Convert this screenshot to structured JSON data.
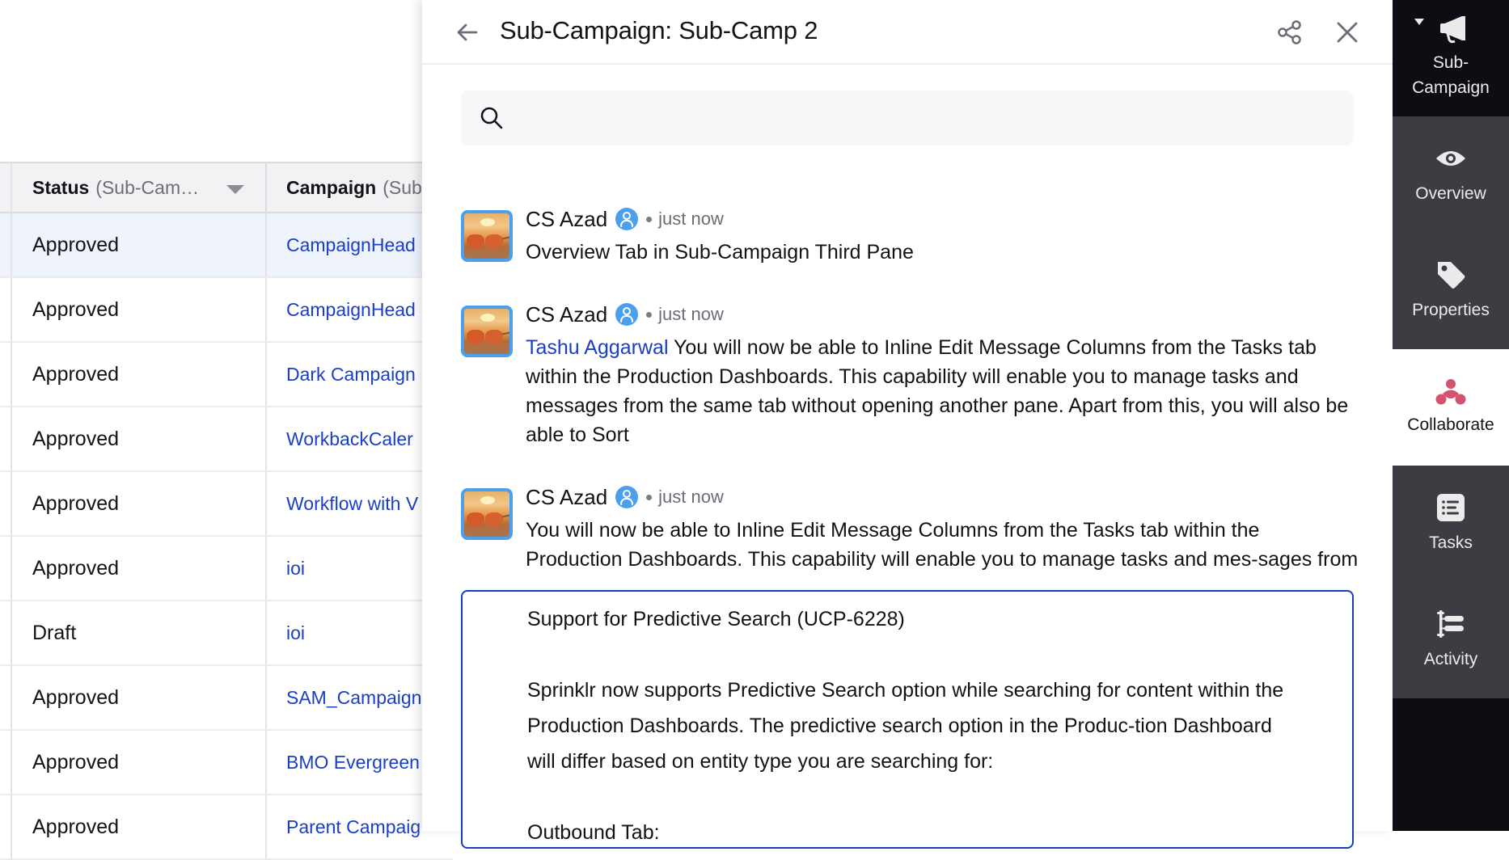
{
  "table": {
    "columns": [
      {
        "label": "Status",
        "sub_label": "(Sub-Cam…"
      },
      {
        "label": "Campaign",
        "sub_label": "(Sub"
      }
    ],
    "rows": [
      {
        "status": "Approved",
        "campaign": "CampaignHead",
        "selected": true
      },
      {
        "status": "Approved",
        "campaign": "CampaignHead"
      },
      {
        "status": "Approved",
        "campaign": "Dark Campaign"
      },
      {
        "status": "Approved",
        "campaign": "WorkbackCaler"
      },
      {
        "status": "Approved",
        "campaign": "Workflow with V"
      },
      {
        "status": "Approved",
        "campaign": "ioi"
      },
      {
        "status": "Draft",
        "campaign": "ioi"
      },
      {
        "status": "Approved",
        "campaign": "SAM_Campaign"
      },
      {
        "status": "Approved",
        "campaign": "BMO Evergreen"
      },
      {
        "status": "Approved",
        "campaign": "Parent Campaig"
      }
    ]
  },
  "pane": {
    "title": "Sub-Campaign: Sub-Camp 2",
    "search": {
      "placeholder": "",
      "value": ""
    },
    "messages": [
      {
        "author": "CS Azad",
        "time": "just now",
        "mention": "",
        "body": "Overview Tab in Sub-Campaign Third Pane"
      },
      {
        "author": "CS Azad",
        "time": "just now",
        "mention": "Tashu Aggarwal",
        "body": " You will now be able to Inline Edit Message Columns from the Tasks tab within the Production Dashboards. This capability will enable you to manage tasks and messages from the same tab without opening another pane. Apart from this, you will also be able to Sort"
      },
      {
        "author": "CS Azad",
        "time": "just now",
        "mention": "",
        "body": "You will now be able to Inline Edit Message Columns from the Tasks tab within the Production Dashboards. This capability will enable you to manage tasks and mes-sages from the same tab without opening another pane. Apart from this, you will also"
      }
    ],
    "composer": {
      "lines": [
        "Support for Predictive Search (UCP-6228)",
        "",
        "Sprinklr now supports Predictive Search option while searching for content within the Production Dashboards. The predictive search option in the Produc-tion Dashboard will differ based on entity type you are searching for:",
        "",
        "Outbound Tab:"
      ]
    }
  },
  "rail": {
    "items": [
      {
        "label": "Sub-\nCampaign",
        "icon": "megaphone-icon"
      },
      {
        "label": "Overview",
        "icon": "eye-icon"
      },
      {
        "label": "Properties",
        "icon": "tag-icon"
      },
      {
        "label": "Collaborate",
        "icon": "collaborate-icon",
        "active": true
      },
      {
        "label": "Tasks",
        "icon": "task-list-icon"
      },
      {
        "label": "Activity",
        "icon": "activity-icon"
      }
    ]
  },
  "colors": {
    "link": "#1a3fc4",
    "accent_border": "#1a3fb4",
    "avatar_border": "#4aa0ee",
    "collaborate_icon": "#d4526e",
    "rail_dark": "#0d0e14",
    "rail_item": "#3c3d43"
  }
}
